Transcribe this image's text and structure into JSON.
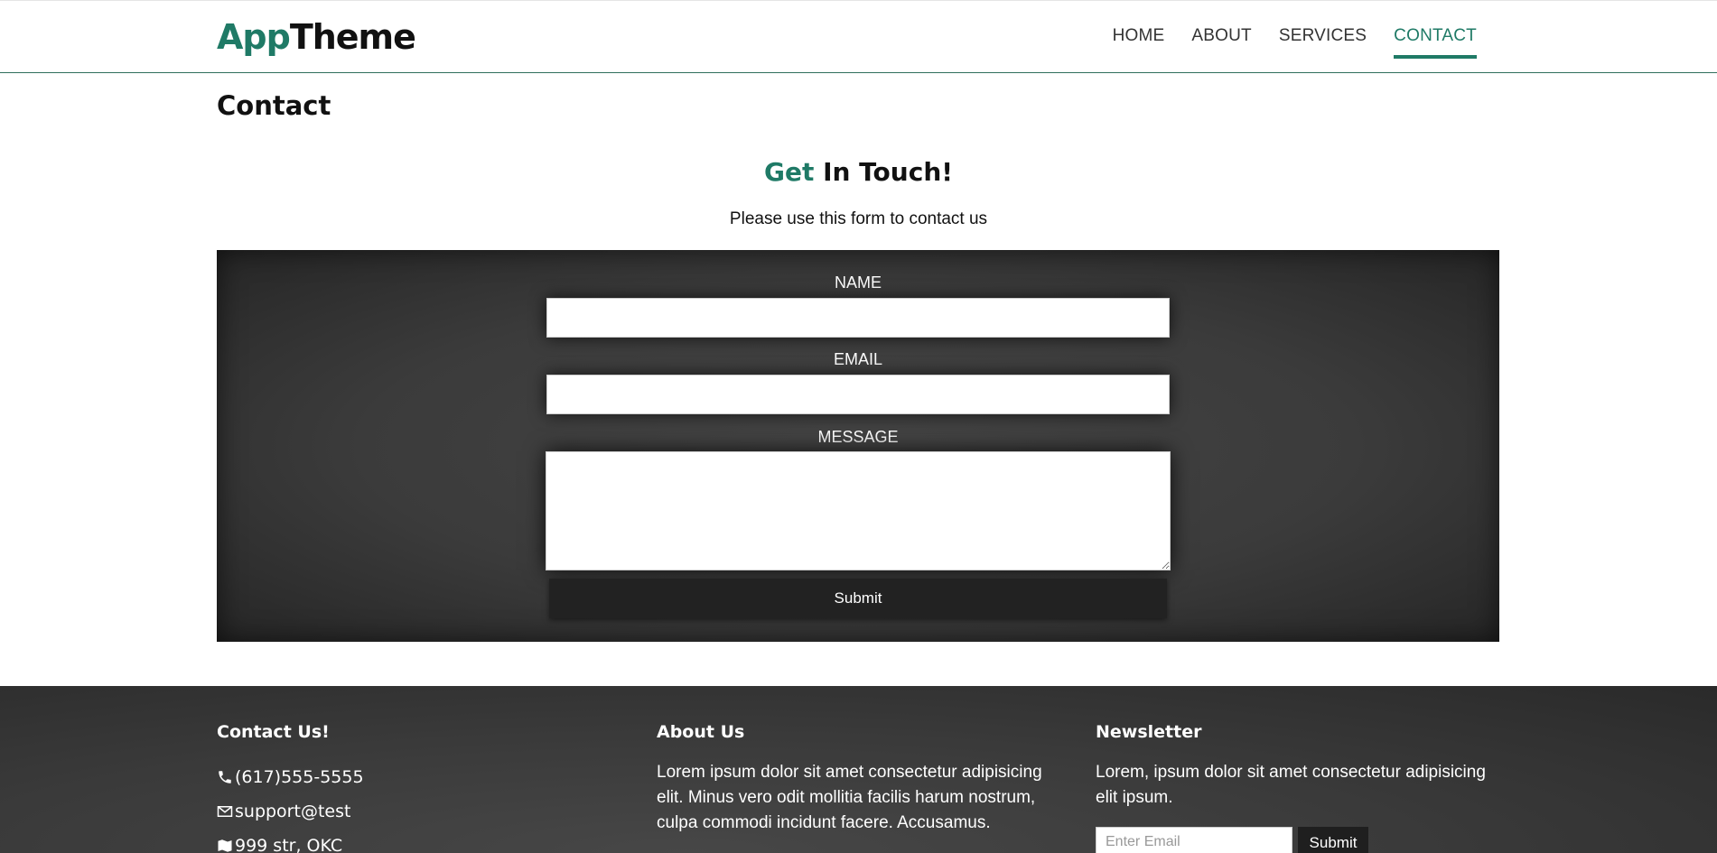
{
  "header": {
    "brand_accent": "App",
    "brand_rest": "Theme",
    "nav": [
      {
        "label": "HOME",
        "active": false
      },
      {
        "label": "ABOUT",
        "active": false
      },
      {
        "label": "SERVICES",
        "active": false
      },
      {
        "label": "CONTACT",
        "active": true
      }
    ]
  },
  "page": {
    "title": "Contact",
    "hero_accent": "Get",
    "hero_rest": " In Touch!",
    "hero_sub": "Please use this form to contact us"
  },
  "form": {
    "name_label": "NAME",
    "name_value": "",
    "email_label": "EMAIL",
    "email_value": "",
    "message_label": "MESSAGE",
    "message_value": "",
    "submit_label": "Submit"
  },
  "footer": {
    "contact": {
      "heading": "Contact Us!",
      "phone": "(617)555-5555",
      "email": "support@test",
      "address": "999 str, OKC",
      "icons": [
        "phone-icon",
        "envelope-icon",
        "map-icon"
      ]
    },
    "about": {
      "heading": "About Us",
      "text": "Lorem ipsum dolor sit amet consectetur adipisicing elit. Minus vero odit mollitia facilis harum nostrum, culpa commodi incidunt facere. Accusamus."
    },
    "newsletter": {
      "heading": "Newsletter",
      "text": "Lorem, ipsum dolor sit amet consectetur adipisicing elit ipsum.",
      "placeholder": "Enter Email",
      "button_label": "Submit"
    }
  },
  "colors": {
    "accent": "#1f7a66",
    "form_bg": "#3b3b3b",
    "footer_bg": "#3a3a3a"
  }
}
